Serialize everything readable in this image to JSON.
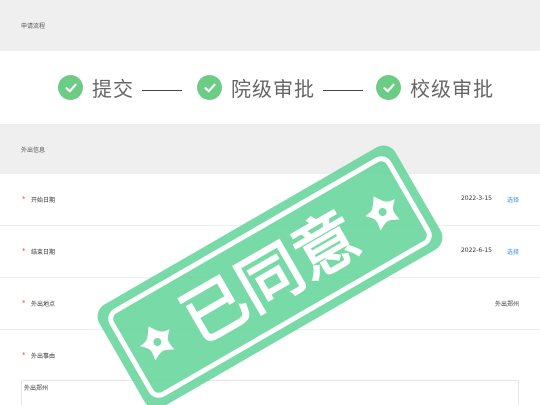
{
  "process_section": {
    "title": "申请流程"
  },
  "steps": [
    {
      "label": "提交"
    },
    {
      "label": "院级审批"
    },
    {
      "label": "校级审批"
    }
  ],
  "info_section": {
    "title": "外出信息"
  },
  "fields": {
    "start_date": {
      "label": "开始日期",
      "value": "2022-3-15",
      "action": "选择"
    },
    "end_date": {
      "label": "结束日期",
      "value": "2022-6-15",
      "action": "选择"
    },
    "location": {
      "label": "外出地点",
      "value": "外出郑州"
    },
    "reason": {
      "label": "外出事由",
      "value": "外出郑州"
    }
  },
  "stamp": {
    "text": "已同意",
    "color": "#6dd7a0"
  },
  "colors": {
    "check": "#6ccc86",
    "link": "#3a8ee6",
    "required": "#e5484d"
  }
}
